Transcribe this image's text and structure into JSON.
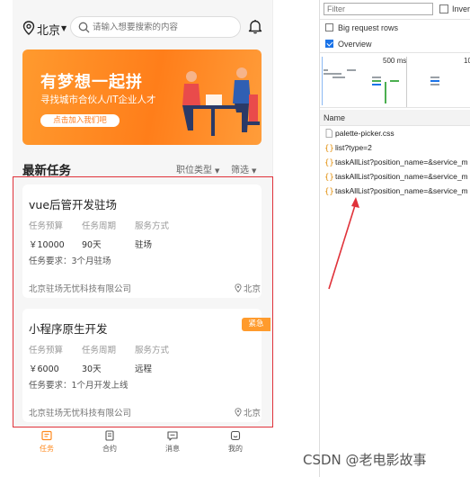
{
  "app": {
    "city": "北京",
    "search_placeholder": "请输入想要搜索的内容",
    "banner": {
      "title": "有梦想一起拼",
      "subtitle": "寻找城市合伙人/IT企业人才",
      "button": "点击加入我们吧"
    },
    "section_title": "最新任务",
    "filters": {
      "type": "职位类型",
      "screen": "筛选"
    },
    "tasks": [
      {
        "title": "vue后管开发驻场",
        "budget_label": "任务预算",
        "budget": "￥10000",
        "period_label": "任务周期",
        "period": "90天",
        "mode_label": "服务方式",
        "mode": "驻场",
        "requirement": "任务要求：3个月驻场",
        "company": "北京驻场无忧科技有限公司",
        "city": "北京",
        "badge": ""
      },
      {
        "title": "小程序原生开发",
        "budget_label": "任务预算",
        "budget": "￥6000",
        "period_label": "任务周期",
        "period": "30天",
        "mode_label": "服务方式",
        "mode": "远程",
        "requirement": "任务要求：1个月开发上线",
        "company": "北京驻场无忧科技有限公司",
        "city": "北京",
        "badge": "紧急"
      }
    ],
    "tabs": [
      {
        "label": "任务",
        "icon": "task-icon",
        "active": true
      },
      {
        "label": "合约",
        "icon": "contract-icon",
        "active": false
      },
      {
        "label": "消息",
        "icon": "message-icon",
        "active": false
      },
      {
        "label": "我的",
        "icon": "profile-icon",
        "active": false
      }
    ],
    "accent_color": "#ff8a1e"
  },
  "devtools": {
    "filter_placeholder": "Filter",
    "invert_label": "Inver",
    "big_rows_label": "Big request rows",
    "overview_label": "Overview",
    "tick_500": "500 ms",
    "tick_10": "10",
    "name_header": "Name",
    "requests": [
      "palette-picker.css",
      "list?type=2",
      "taskAllList?position_name=&service_m",
      "taskAllList?position_name=&service_m",
      "taskAllList?position_name=&service_m"
    ]
  },
  "watermark": "CSDN @老电影故事"
}
